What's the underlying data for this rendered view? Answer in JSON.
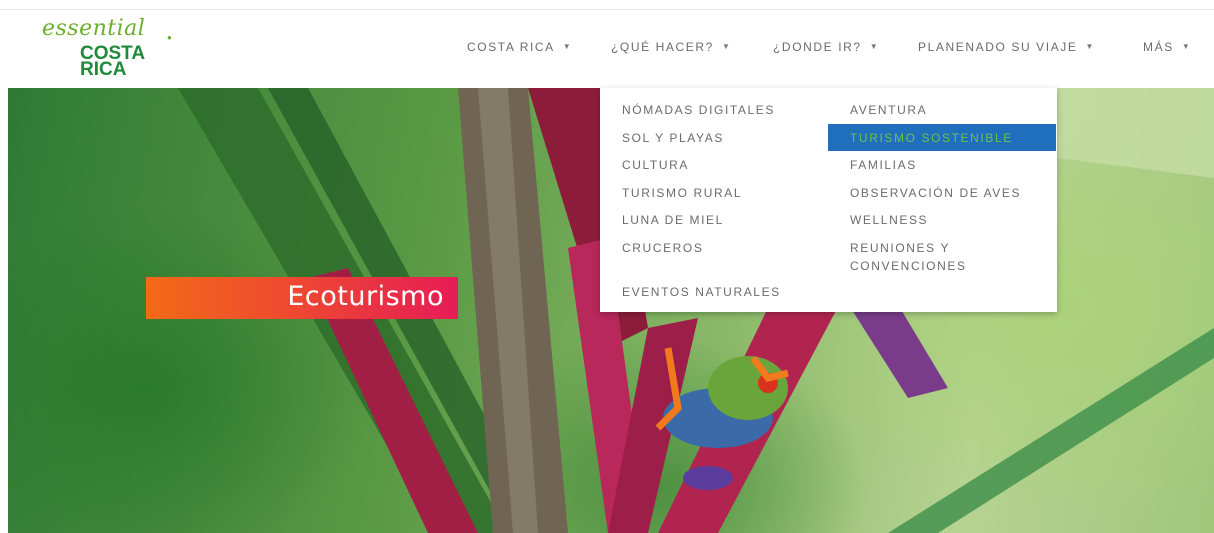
{
  "logo": {
    "script": "essential",
    "line1": "COSTA",
    "line2": "RICA"
  },
  "nav": {
    "items": [
      {
        "label": "COSTA RICA"
      },
      {
        "label": "¿QUÉ HACER?"
      },
      {
        "label": "¿DONDE IR?"
      },
      {
        "label": "PLANENADO SU VIAJE"
      },
      {
        "label": "MÁS"
      }
    ],
    "caret": "▼"
  },
  "dropdown": {
    "column1": [
      {
        "label": "NÓMADAS DIGITALES"
      },
      {
        "label": "SOL Y PLAYAS"
      },
      {
        "label": "CULTURA"
      },
      {
        "label": "TURISMO RURAL"
      },
      {
        "label": "LUNA DE MIEL"
      },
      {
        "label": "CRUCEROS"
      },
      {
        "label": "EVENTOS NATURALES"
      }
    ],
    "column2": [
      {
        "label": "AVENTURA"
      },
      {
        "label": "TURISMO SOSTENIBLE",
        "active": true
      },
      {
        "label": "FAMILIAS"
      },
      {
        "label": "OBSERVACIÓN DE AVES"
      },
      {
        "label": "WELLNESS"
      },
      {
        "label": "REUNIONES Y CONVENCIONES"
      }
    ]
  },
  "hero": {
    "label": "Ecoturismo"
  },
  "colors": {
    "brand_green": "#1f8a3a",
    "logo_light_green": "#6cae2c",
    "active_bg": "#1f6fbd",
    "active_text": "#6cc24a",
    "label_gradient_start": "#f26a17",
    "label_gradient_end": "#e61c56",
    "nav_text": "#6b6b6b"
  }
}
